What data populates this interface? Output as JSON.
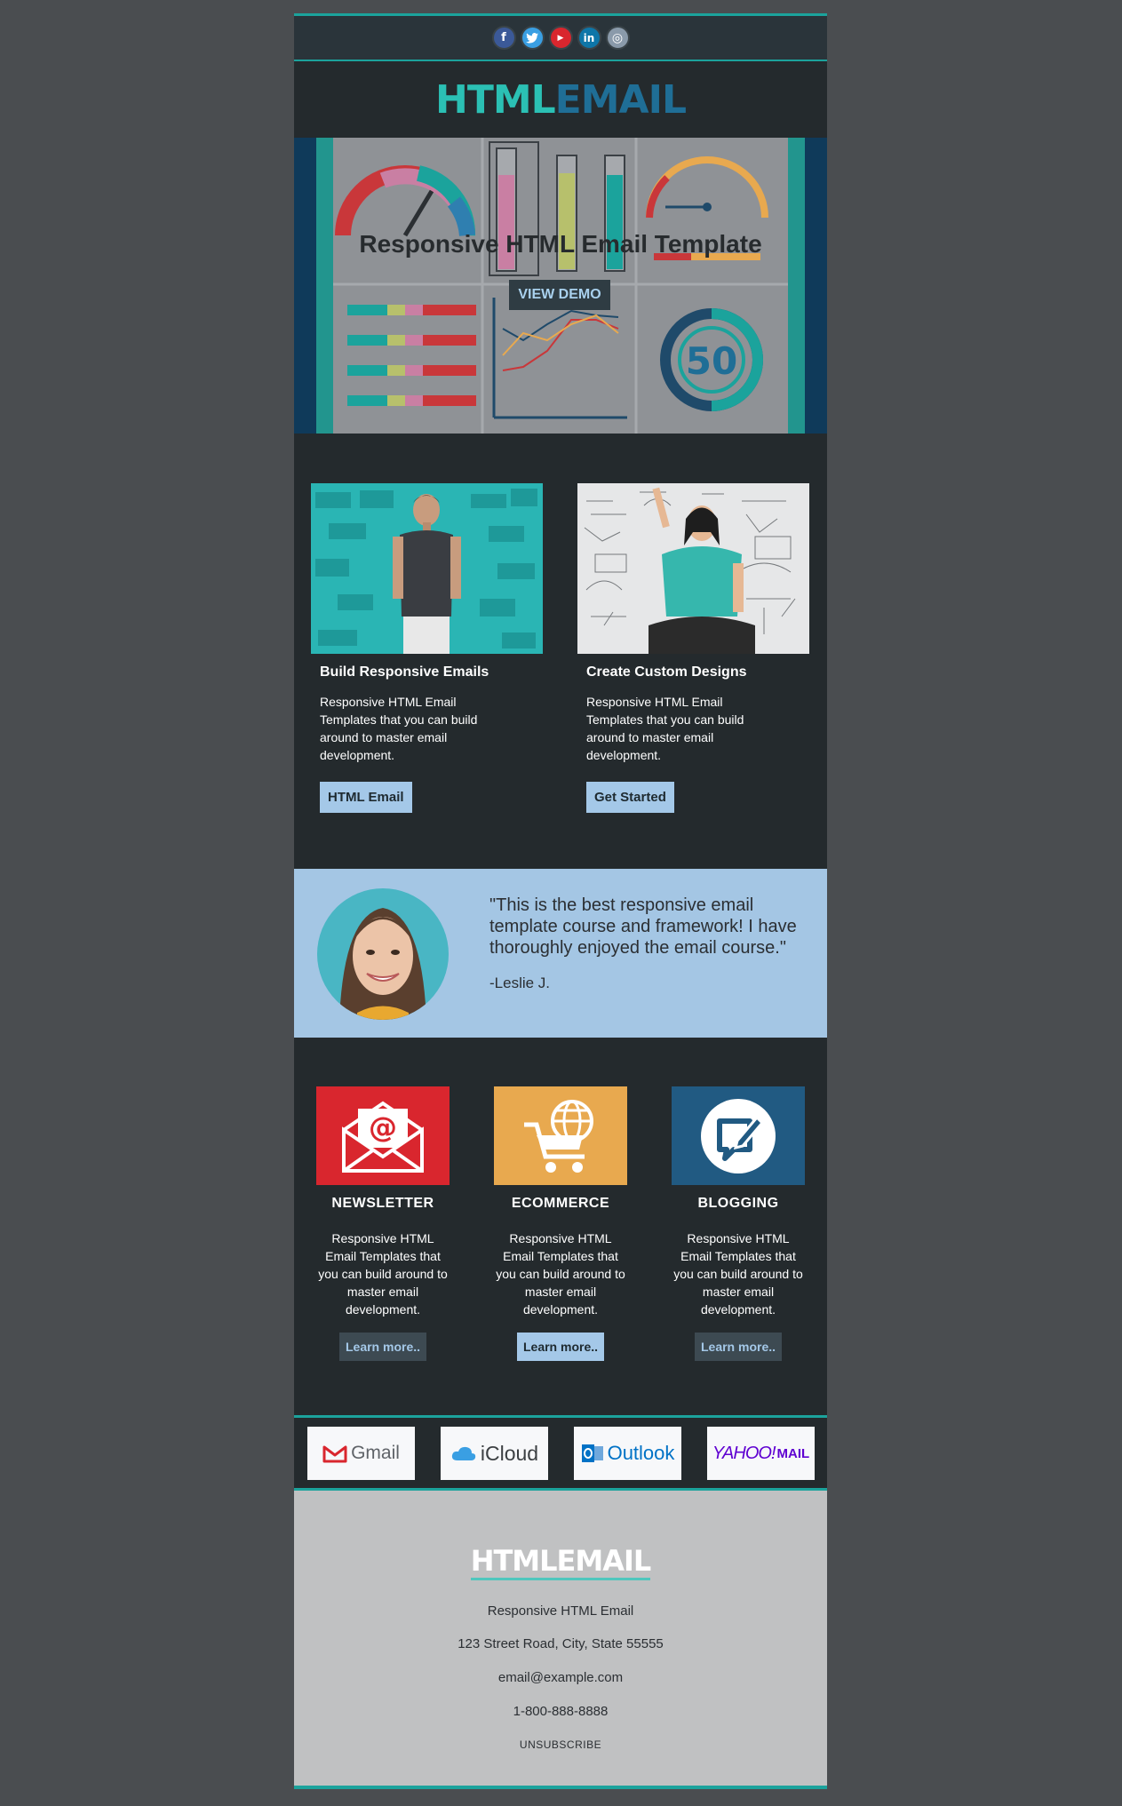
{
  "social": [
    "f",
    "t",
    "▶",
    "in",
    "◎"
  ],
  "colors": {
    "teal": "#1ba39c",
    "dark": "#242a2d",
    "light_blue": "#a4c6e4",
    "red": "#d9262e",
    "orange": "#e8a94f",
    "navy": "#215a82"
  },
  "logo": {
    "part1": "HTML",
    "part2": "EMAIL"
  },
  "hero": {
    "title": "Responsive HTML Email Template",
    "button": "VIEW DEMO",
    "gauge_number": "50"
  },
  "two_col": [
    {
      "title": "Build Responsive Emails",
      "text": "Responsive HTML Email Templates that you can build around to master email development.",
      "button": "HTML Email"
    },
    {
      "title": "Create Custom Designs",
      "text": "Responsive HTML Email Templates that you can build around to master email development.",
      "button": "Get Started"
    }
  ],
  "testimonial": {
    "quote": "\"This is the best responsive email template course and framework! I have thoroughly enjoyed the email course.\"",
    "author": "-Leslie J."
  },
  "three_col": [
    {
      "icon": "email-at-icon",
      "title": "NEWSLETTER",
      "text": "Responsive HTML Email Templates that you can build around to master email development.",
      "button": "Learn more.."
    },
    {
      "icon": "cart-globe-icon",
      "title": "ECOMMERCE",
      "text": "Responsive HTML Email Templates that you can build around to master email development.",
      "button": "Learn more.."
    },
    {
      "icon": "chat-pen-icon",
      "title": "BLOGGING",
      "text": "Responsive HTML Email Templates that you can build around to master email development.",
      "button": "Learn more.."
    }
  ],
  "clients": {
    "gmail": "Gmail",
    "icloud": "iCloud",
    "outlook": "Outlook",
    "yahoo": "YAHOO!",
    "yahoo_mail": "MAIL"
  },
  "footer": {
    "logo": "HTMLEMAIL",
    "company": "Responsive HTML Email",
    "address": "123 Street Road, City, State 55555",
    "email": "email@example.com",
    "phone": "1-800-888-8888",
    "unsubscribe": "UNSUBSCRIBE"
  }
}
